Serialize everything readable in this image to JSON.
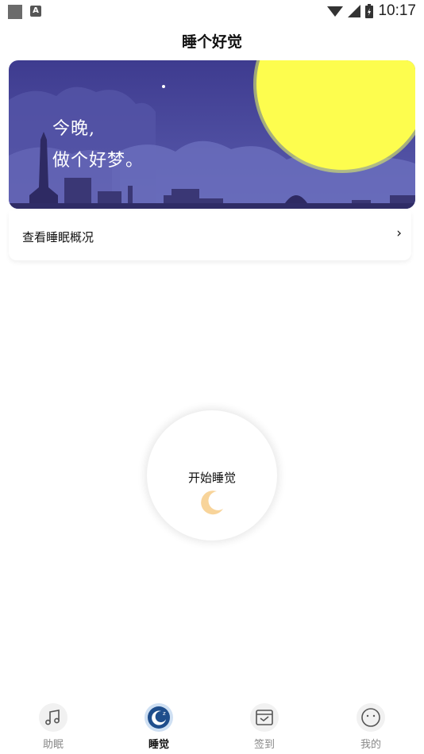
{
  "status_bar": {
    "time": "10:17",
    "notification_badge": "A"
  },
  "header": {
    "title": "睡个好觉"
  },
  "banner": {
    "line1": "今晚,",
    "line2": "做个好梦。"
  },
  "overview": {
    "label": "查看睡眠概况",
    "chevron": "›"
  },
  "start_button": {
    "label": "开始睡觉"
  },
  "tabs": [
    {
      "label": "助眠",
      "icon": "music-note-icon"
    },
    {
      "label": "睡觉",
      "icon": "sleep-moon-icon"
    },
    {
      "label": "签到",
      "icon": "checkin-tray-icon"
    },
    {
      "label": "我的",
      "icon": "profile-face-icon"
    }
  ],
  "colors": {
    "banner_sky": "#4b4a9c",
    "moon_yellow": "#fdfd4e",
    "active_tab": "#1f4e8c",
    "accent_moon": "#f8d49a"
  }
}
